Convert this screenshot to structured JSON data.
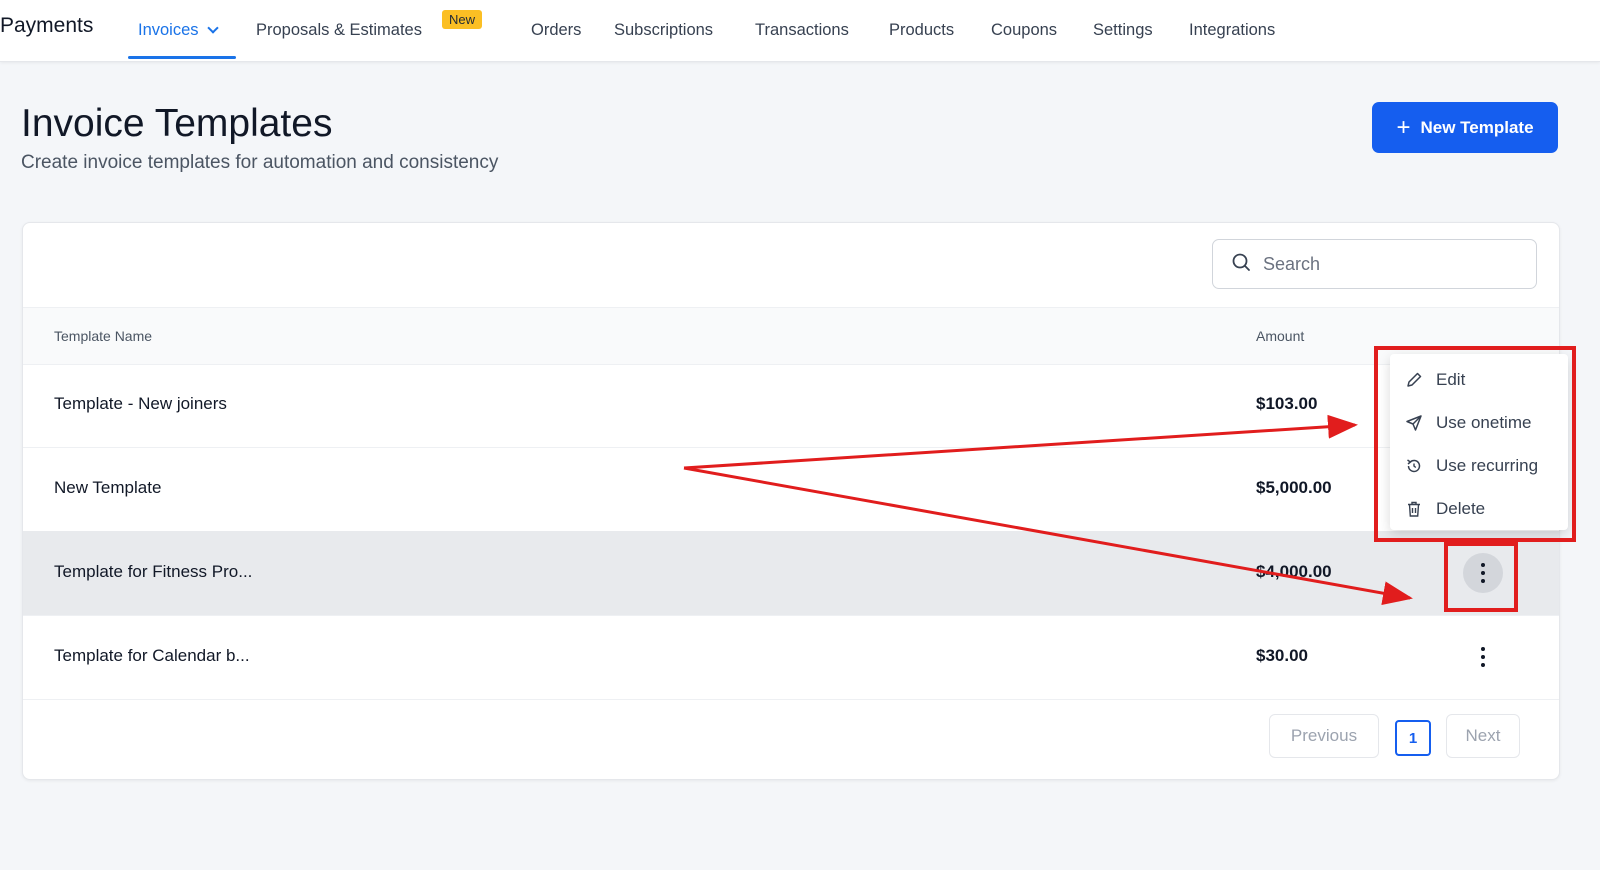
{
  "app": {
    "title": "Payments"
  },
  "nav": {
    "items": [
      {
        "label": "Invoices"
      },
      {
        "label": "Proposals & Estimates"
      },
      {
        "label": "Orders"
      },
      {
        "label": "Subscriptions"
      },
      {
        "label": "Transactions"
      },
      {
        "label": "Products"
      },
      {
        "label": "Coupons"
      },
      {
        "label": "Settings"
      },
      {
        "label": "Integrations"
      }
    ],
    "new_badge": "New"
  },
  "page": {
    "title": "Invoice Templates",
    "subtitle": "Create invoice templates for automation and consistency",
    "new_button_label": "New Template"
  },
  "search": {
    "placeholder": "Search"
  },
  "table": {
    "headers": {
      "name": "Template Name",
      "amount": "Amount"
    },
    "rows": [
      {
        "name": "Template - New joiners",
        "amount": "$103.00"
      },
      {
        "name": "New Template",
        "amount": "$5,000.00"
      },
      {
        "name": "Template for Fitness Pro...",
        "amount": "$4,000.00"
      },
      {
        "name": "Template for Calendar b...",
        "amount": "$30.00"
      }
    ]
  },
  "row_menu": {
    "items": [
      {
        "label": "Edit",
        "icon": "pencil-icon"
      },
      {
        "label": "Use onetime",
        "icon": "send-icon"
      },
      {
        "label": "Use recurring",
        "icon": "recurring-icon"
      },
      {
        "label": "Delete",
        "icon": "trash-icon"
      }
    ]
  },
  "pagination": {
    "previous": "Previous",
    "current": "1",
    "next": "Next"
  },
  "colors": {
    "accent": "#155eef",
    "annotation": "#e11d1d",
    "badge": "#fbbf24"
  }
}
